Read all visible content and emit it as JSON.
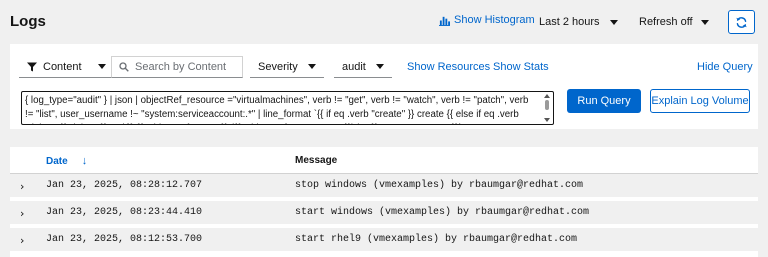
{
  "header": {
    "title": "Logs",
    "show_histogram": "Show Histogram",
    "time_range": "Last 2 hours",
    "refresh": "Refresh off",
    "refresh_icon": "sync-icon"
  },
  "filters": {
    "attribute": "Content",
    "search_placeholder": "Search by Content",
    "severity": "Severity",
    "tenant": "audit",
    "show_resources": "Show Resources",
    "show_stats": "Show Stats",
    "hide_query": "Hide Query"
  },
  "query": {
    "text": "{ log_type=\"audit\" } | json | objectRef_resource =\"virtualmachines\", verb != \"get\", verb != \"watch\", verb != \"patch\", verb != \"list\", user_username !~ \"system:serviceaccount:.*\" | line_format `{{ if eq .verb \"create\" }} create {{ else if eq .verb \"delete\" }} delete {{ end }} {{ .objectRef_name }} ({{ .objectRef_namespace }}) by {{ .user_username }}`",
    "run_label": "Run Query",
    "explain_label": "Explain Log Volume"
  },
  "table": {
    "columns": [
      "Date",
      "Message"
    ],
    "rows": [
      {
        "date": "Jan 23, 2025, 08:28:12.707",
        "message": "stop windows (vmexamples) by rbaumgar@redhat.com"
      },
      {
        "date": "Jan 23, 2025, 08:23:44.410",
        "message": "start windows (vmexamples) by rbaumgar@redhat.com"
      },
      {
        "date": "Jan 23, 2025, 08:12:53.700",
        "message": "start rhel9 (vmexamples) by rbaumgar@redhat.com"
      }
    ]
  },
  "colors": {
    "accent": "#0066cc",
    "background": "#f0f0f0"
  }
}
